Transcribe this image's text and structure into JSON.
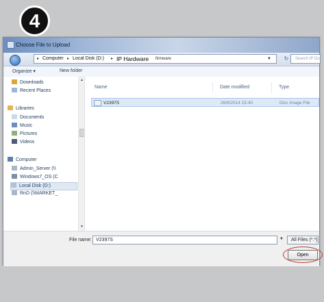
{
  "window": {
    "title": "Choose File to Upload",
    "colors": {
      "accent": "#2f6bbf",
      "highlight_ring": "#c0392b",
      "badge": "#111111"
    }
  },
  "step_badge": {
    "number": "4"
  },
  "address": {
    "crumbs": [
      "Computer",
      "Local Disk (D:)",
      "IP Hardware",
      "firmware"
    ],
    "separator": "▸",
    "search_placeholder": "Search IP Do"
  },
  "toolbar": {
    "organize": "Organize ▾",
    "new_folder": "New folder"
  },
  "nav": {
    "favorites": [
      {
        "label": "Downloads",
        "icon": "downloads-folder-icon"
      },
      {
        "label": "Recent Places",
        "icon": "recent-places-icon"
      }
    ],
    "libraries_label": "Libraries",
    "libraries": [
      {
        "label": "Documents",
        "icon": "documents-icon"
      },
      {
        "label": "Music",
        "icon": "music-icon"
      },
      {
        "label": "Pictures",
        "icon": "pictures-icon"
      },
      {
        "label": "Videos",
        "icon": "videos-icon"
      }
    ],
    "computer_label": "Computer",
    "drives": [
      {
        "label": "Admin_Server (\\\\",
        "icon": "network-drive-icon"
      },
      {
        "label": "Windows7_OS (C",
        "icon": "system-drive-icon"
      },
      {
        "label": "Local Disk (D:)",
        "icon": "local-drive-icon"
      },
      {
        "label": "RnD (\\\\MARKET_",
        "icon": "network-drive-icon"
      }
    ]
  },
  "columns": {
    "name": "Name",
    "date": "Date modified",
    "type": "Type"
  },
  "files": [
    {
      "name": "V2397S",
      "date": "26/9/2014 15:40",
      "type": "Disc Image File"
    }
  ],
  "bottom": {
    "file_name_label": "File name:",
    "file_name_value": "V2397S",
    "file_type": "All Files (*.*)",
    "open_label": "Open"
  }
}
